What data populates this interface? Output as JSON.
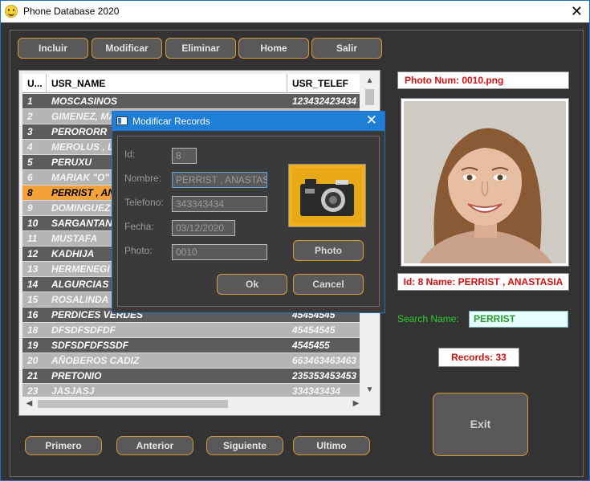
{
  "window": {
    "title": "Phone Database 2020"
  },
  "toolbar": {
    "incluir": "Incluir",
    "modificar": "Modificar",
    "eliminar": "Eliminar",
    "home": "Home",
    "salir": "Salir"
  },
  "grid": {
    "columns": [
      "U...",
      "USR_NAME",
      "USR_TELEF"
    ],
    "rows": [
      {
        "id": "1",
        "name": "MOSCASINOS",
        "tel": "123432423434"
      },
      {
        "id": "2",
        "name": "GIMENEZ, MA",
        "tel": ""
      },
      {
        "id": "3",
        "name": "PERORORR",
        "tel": ""
      },
      {
        "id": "4",
        "name": "MEROLUS , L",
        "tel": ""
      },
      {
        "id": "5",
        "name": "PERUXU",
        "tel": ""
      },
      {
        "id": "6",
        "name": "MARIAK  \"O\"",
        "tel": ""
      },
      {
        "id": "8",
        "name": "PERRIST , AN",
        "tel": ""
      },
      {
        "id": "9",
        "name": "DOMINGUEZ",
        "tel": ""
      },
      {
        "id": "10",
        "name": "SARGANTAN",
        "tel": ""
      },
      {
        "id": "11",
        "name": "MUSTAFA",
        "tel": ""
      },
      {
        "id": "12",
        "name": "KADHIJA",
        "tel": ""
      },
      {
        "id": "13",
        "name": "HERMENEGI",
        "tel": ""
      },
      {
        "id": "14",
        "name": "ALGURCIAS",
        "tel": ""
      },
      {
        "id": "15",
        "name": "ROSALINDA",
        "tel": ""
      },
      {
        "id": "16",
        "name": "PERDICES VERDES",
        "tel": "45454545"
      },
      {
        "id": "18",
        "name": "DFSDFSDFDF",
        "tel": "45454545"
      },
      {
        "id": "19",
        "name": "SDFSDFDFSSDF",
        "tel": "4545455"
      },
      {
        "id": "20",
        "name": "AÑOBEROS CADIZ",
        "tel": "663463463463"
      },
      {
        "id": "21",
        "name": "PRETONIO",
        "tel": "235353453453"
      },
      {
        "id": "23",
        "name": "JASJASJ",
        "tel": "334343434"
      }
    ],
    "selected_row_index": 6
  },
  "nav": {
    "primero": "Primero",
    "anterior": "Anterior",
    "siguiente": "Siguiente",
    "ultimo": "Ultimo"
  },
  "info": {
    "photo_num": "Photo Num:   0010.png",
    "id_name": "Id: 8   Name: PERRIST , ANASTASIA",
    "search_label": "Search Name:",
    "search_value": "PERRIST",
    "records": "Records:  33",
    "exit": "Exit"
  },
  "dialog": {
    "title": "Modificar Records",
    "labels": {
      "id": "Id:",
      "nombre": "Nombre:",
      "telefono": "Telefono:",
      "fecha": "Fecha:",
      "photo": "Photo:"
    },
    "values": {
      "id": "8",
      "nombre": "PERRIST , ANASTASIA",
      "telefono": "343343434",
      "fecha": "03/12/2020",
      "photo": "0010"
    },
    "photo_button": "Photo",
    "ok_button": "Ok",
    "cancel_button": "Cancel"
  },
  "colors": {
    "accent_border": "#d89b3b",
    "selected_row": "#f2a13b",
    "info_text": "#d01010",
    "search_label": "#2fcf2f",
    "dialog_title": "#1f7ed6"
  }
}
